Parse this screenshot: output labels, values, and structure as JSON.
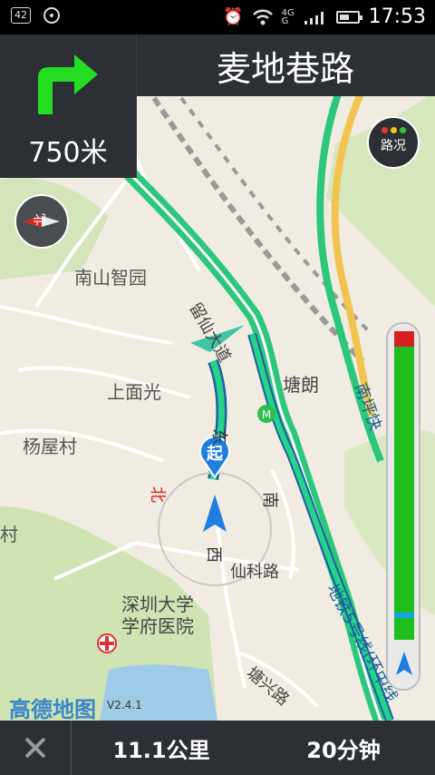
{
  "status_bar": {
    "notification_badge": "42",
    "network_label": "4G G",
    "clock": "17:53"
  },
  "navigation": {
    "next_road": "麦地巷路",
    "turn_distance": "750米",
    "turn_icon": "right-turn-arrow-icon",
    "turn_icon_color": "#22dd22"
  },
  "traffic_button": {
    "label": "路况",
    "colors": [
      "#e23b2f",
      "#f4c418",
      "#35c335"
    ]
  },
  "compass": {
    "north_label": "北"
  },
  "map": {
    "places": {
      "nanshan_zhiyuan": "南山智园",
      "shangmianguang": "上面光",
      "yangwucun": "杨屋村",
      "tanglang": "塘朗",
      "shenzhen_daxue": "深圳大学",
      "xuefu_yiyuan": "学府医院",
      "cun": "村"
    },
    "roads": {
      "liuxian_dadao": "留仙大道",
      "xianke_road": "仙科路",
      "tangxing_road": "塘兴路",
      "metro_line5": "地铁5号线(环中线",
      "nanping": "南坪快"
    },
    "start_marker": "起",
    "directions": {
      "north": "北",
      "south": "南",
      "east": "东",
      "west": "西"
    },
    "logo": "高德地图",
    "version": "V2.4.1",
    "road_green": "#2cc77a"
  },
  "route_progress": {
    "completed_color": "#d42020",
    "remaining_color": "#1fbe1f"
  },
  "bottom_bar": {
    "remaining_distance": "11.1公里",
    "remaining_time": "20分钟"
  }
}
